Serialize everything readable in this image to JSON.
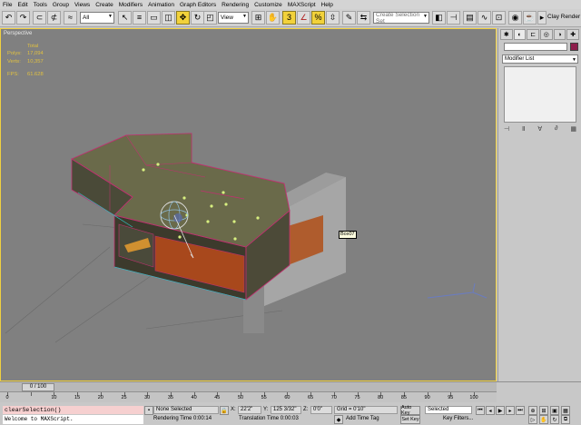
{
  "menu": [
    "File",
    "Edit",
    "Tools",
    "Group",
    "Views",
    "Create",
    "Modifiers",
    "Animation",
    "Graph Editors",
    "Rendering",
    "Customize",
    "MAXScript",
    "Help"
  ],
  "toolbar": {
    "filter_value": "All",
    "refcoord_value": "View",
    "selection_set_placeholder": "Create Selection Set",
    "clay_render_label": "Clay Render"
  },
  "viewport": {
    "label": "Perspective",
    "stats": {
      "header": "Total",
      "polys_label": "Polys:",
      "polys_value": "17,094",
      "verts_label": "Verts:",
      "verts_value": "10,357",
      "fps_label": "FPS:",
      "fps_value": "61.628"
    },
    "object_tag": "Box07"
  },
  "command_panel": {
    "modifier_list": "Modifier List",
    "object_color": "#8e1e4c"
  },
  "timeline": {
    "frame_label": "0 / 100",
    "ticks": [
      "0",
      "10",
      "15",
      "20",
      "25",
      "30",
      "35",
      "40",
      "45",
      "50",
      "55",
      "60",
      "65",
      "70",
      "75",
      "80",
      "85",
      "90",
      "95",
      "100"
    ]
  },
  "status": {
    "listener_command": "clearSelection()",
    "listener_output": "Welcome to MAXScript.",
    "selection_status": "None Selected",
    "render_time": "Rendering Time  0:00:14",
    "x_label": "X:",
    "x_value": "22'2\"",
    "y_label": "Y:",
    "y_value": "125 3/32\"",
    "z_label": "Z:",
    "z_value": "0'0\"",
    "translation_time": "Translation Time  0:00:03",
    "grid": "Grid = 0'10\"",
    "add_time_tag": "Add Time Tag",
    "auto_key": "Auto Key",
    "set_key": "Set Key",
    "key_mode_selected": "Selected",
    "key_filters": "Key Filters..."
  }
}
